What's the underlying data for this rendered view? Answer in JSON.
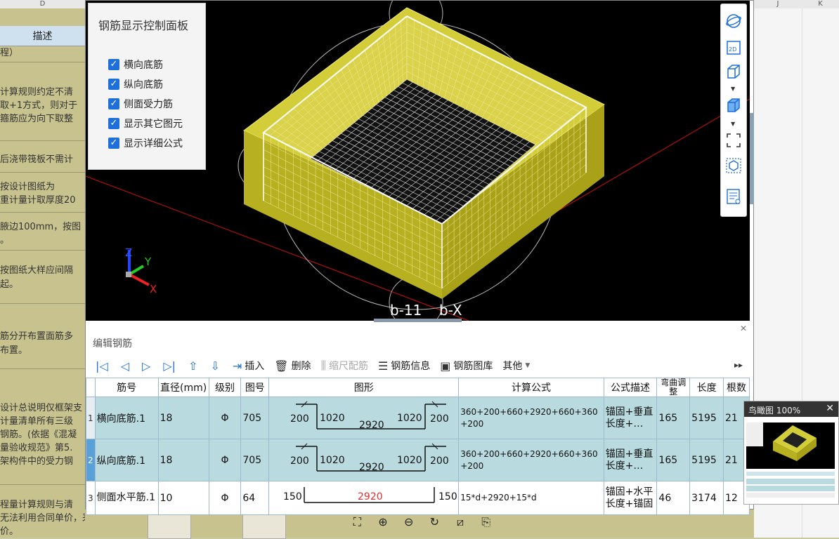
{
  "sheet": {
    "columns": [
      "D",
      "J",
      "K"
    ],
    "header_label": "描述",
    "rows": [
      "程）",
      "计算规则约定不清",
      "取+1方式，则对于",
      "箍筋应为向下取整",
      "后浇带筏板不需计",
      "按设计图纸为",
      "重计量计取厚度20",
      "腋边100mm，按图",
      "。",
      "按图纸大样应间隔",
      "起。",
      "筋分开布置面筋多",
      "布置。",
      "设计总说明仅框架支",
      "计量清单所有三级",
      "钢筋。(依据《混凝",
      "量验收规范》第5.",
      "架构件中的受力钢",
      "程量计算规则与清",
      "无法利用合同单价，采用",
      "价。"
    ]
  },
  "control_panel": {
    "title": "钢筋显示控制面板",
    "options": [
      {
        "label": "横向底筋",
        "checked": true
      },
      {
        "label": "纵向底筋",
        "checked": true
      },
      {
        "label": "侧面受力筋",
        "checked": true
      },
      {
        "label": "显示其它图元",
        "checked": true
      },
      {
        "label": "显示详细公式",
        "checked": true
      }
    ]
  },
  "view3d": {
    "labels": {
      "b11": "b-11",
      "bx": "b-X"
    },
    "axes": {
      "x": "X",
      "y": "Y",
      "z": "Z"
    },
    "right_toolbar": [
      "orbit-icon",
      "2d-view-icon",
      "cube-view-icon",
      "cube-solid-icon",
      "fit-frame-icon",
      "box-select-icon",
      "report-view-icon"
    ],
    "toolbar_2d_label": "2D"
  },
  "editor": {
    "title": "编辑钢筋",
    "toolbar": {
      "insert": "插入",
      "delete": "删除",
      "scale": "缩尺配筋",
      "info": "钢筋信息",
      "library": "钢筋图库",
      "other": "其他"
    },
    "columns": [
      "筋号",
      "直径(mm)",
      "级别",
      "图号",
      "图形",
      "计算公式",
      "公式描述",
      "弯曲调整",
      "长度",
      "根数"
    ],
    "rows": [
      {
        "num": "1",
        "name": "横向底筋.1",
        "diameter": "18",
        "grade": "Φ",
        "fig": "705",
        "shape": {
          "a": "200",
          "b": "1020",
          "c": "2920",
          "d": "1020",
          "e": "200"
        },
        "formula": "360+200+660+2920+660+360+200",
        "desc": "锚固+垂直长度+…",
        "bend": "165",
        "length": "5195",
        "count": "21"
      },
      {
        "num": "2",
        "name": "纵向底筋.1",
        "diameter": "18",
        "grade": "Φ",
        "fig": "705",
        "shape": {
          "a": "200",
          "b": "1020",
          "c": "2920",
          "d": "1020",
          "e": "200"
        },
        "formula": "360+200+660+2920+660+360+200",
        "desc": "锚固+垂直长度+…",
        "bend": "165",
        "length": "5195",
        "count": "21"
      },
      {
        "num": "3",
        "name": "侧面水平筋.1",
        "diameter": "10",
        "grade": "Φ",
        "fig": "64",
        "shape": {
          "a": "150",
          "c": "2920",
          "e": "150"
        },
        "formula": "15*d+2920+15*d",
        "desc": "锚固+水平长度+锚固",
        "bend": "46",
        "length": "3174",
        "count": "12"
      }
    ]
  },
  "bird_view": {
    "title": "鸟瞰图 100%"
  },
  "image_tools": [
    "fit-screen-icon",
    "zoom-in-icon",
    "zoom-out-icon",
    "rotate-icon",
    "crop-icon",
    "save-icon"
  ],
  "colors": {
    "accent": "#1e6fd9",
    "row_bg": "#b9dbe0",
    "mesh": "#e8e04a",
    "red_value": "#e03030"
  }
}
